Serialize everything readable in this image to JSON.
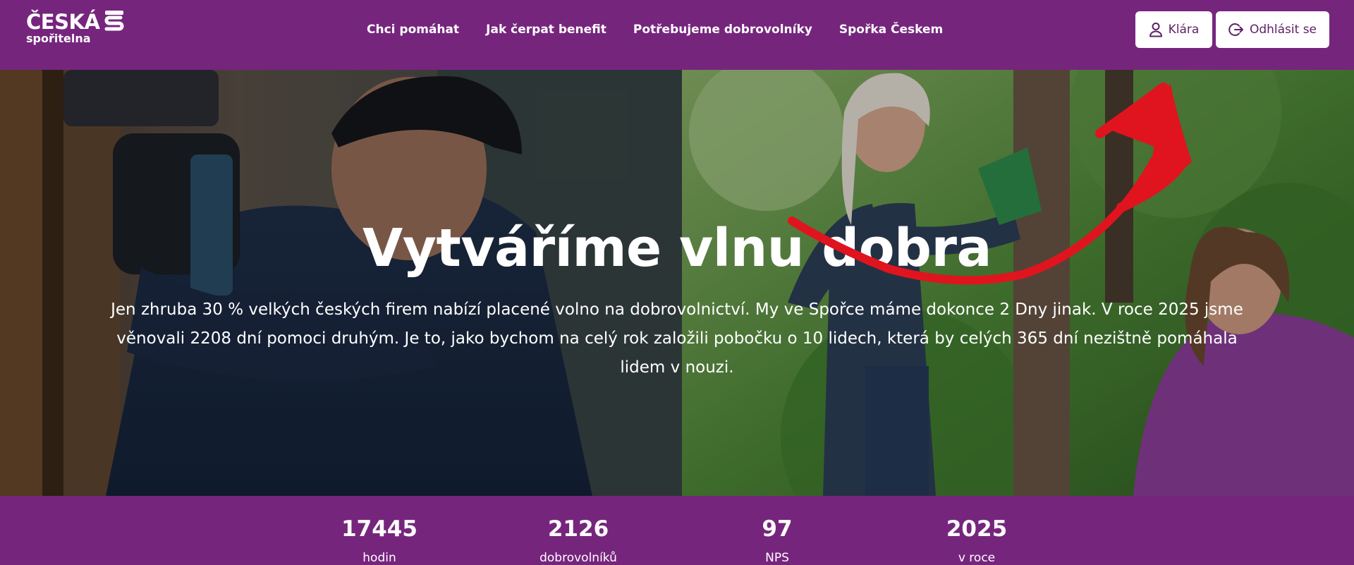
{
  "logo": {
    "line1": "ČESKÁ",
    "line2": "spořitelna"
  },
  "nav": [
    {
      "label": "Chci pomáhat"
    },
    {
      "label": "Jak čerpat benefit"
    },
    {
      "label": "Potřebujeme dobrovolníky"
    },
    {
      "label": "Spořka Českem"
    }
  ],
  "header_buttons": {
    "user": {
      "label": "Klára",
      "icon": "user-icon"
    },
    "logout": {
      "label": "Odhlásit se",
      "icon": "logout-icon"
    }
  },
  "hero": {
    "title": "Vytváříme vlnu dobra",
    "text": "Jen zhruba 30 % velkých českých firem nabízí placené volno na dobrovolnictví. My ve Spořce máme dokonce 2 Dny jinak. V roce 2025 jsme věnovali 2208 dní pomoci druhým. Je to, jako bychom na celý rok založili pobočku o 10 lidech, která by celých 365 dní nezištně pomáhala lidem v nouzi."
  },
  "stats": [
    {
      "value": "17445",
      "label": "hodin"
    },
    {
      "value": "2126",
      "label": "dobrovolníků"
    },
    {
      "value": "97",
      "label": "NPS"
    },
    {
      "value": "2025",
      "label": "v roce"
    }
  ],
  "colors": {
    "brand_purple": "#76257d",
    "arrow_red": "#e0141e",
    "button_text": "#5d1f66"
  }
}
